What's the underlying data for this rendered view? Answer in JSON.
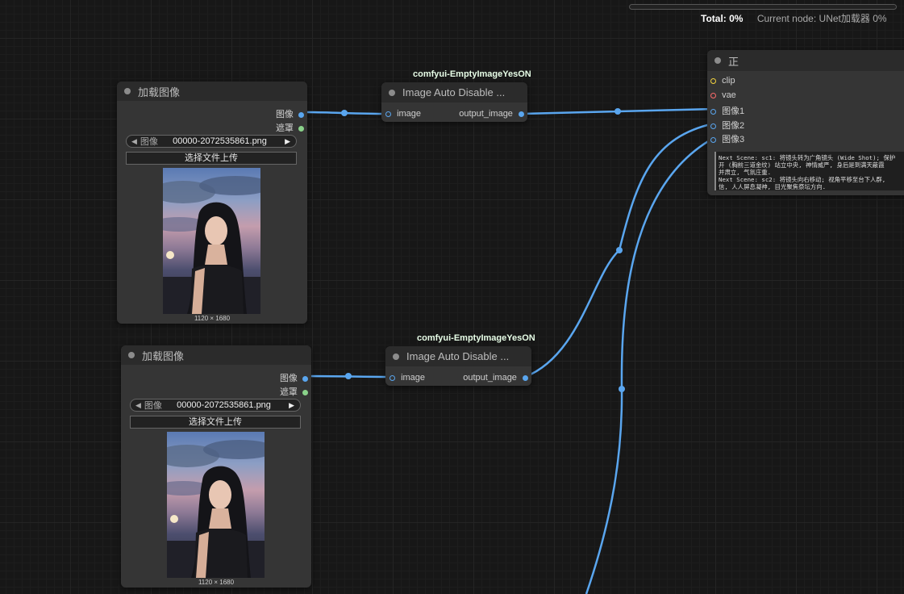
{
  "status": {
    "total_label": "Total:",
    "total_value": "0%",
    "current_node": "Current node: UNet加载器 0%"
  },
  "load_nodes": [
    {
      "title": "加载图像",
      "outputs": [
        "图像",
        "遮罩"
      ],
      "widget_label": "图像",
      "widget_value": "00000-2072535861.png",
      "upload_label": "选择文件上传",
      "dims": "1120 × 1680"
    },
    {
      "title": "加载图像",
      "outputs": [
        "图像",
        "遮罩"
      ],
      "widget_label": "图像",
      "widget_value": "00000-2072535861.png",
      "upload_label": "选择文件上传",
      "dims": "1120 × 1680"
    }
  ],
  "auto_nodes": [
    {
      "badge": "comfyui-EmptyImageYesON",
      "title": "Image Auto Disable ...",
      "input": "image",
      "output": "output_image"
    },
    {
      "badge": "comfyui-EmptyImageYesON",
      "title": "Image Auto Disable ...",
      "input": "image",
      "output": "output_image"
    }
  ],
  "right_node": {
    "title": "正",
    "inputs": [
      "clip",
      "vae",
      "图像1",
      "图像2",
      "图像3"
    ],
    "text_lines": [
      "Next Scene: sc1: 将镜头转为广角镜头 (Wide Shot); 保护",
      "开 (胸前三道金纹) 站立中央, 神情威严, 身后是到满天蔽霞",
      "并肃立, 气氛庄重.",
      "Next Scene: sc2: 将镜头向右移动; 视角平移至台下人群,",
      "信, 人人屏息凝神, 目光聚焦祭坛方向."
    ]
  },
  "colors": {
    "canvas_bg": "#171717",
    "node_bg": "#353535",
    "node_header": "#2b2b2b",
    "link_image": "#5aa6ef",
    "slot_mask": "#8ad28a",
    "slot_clip": "#f3d33e",
    "slot_vae": "#ff6b6b"
  }
}
